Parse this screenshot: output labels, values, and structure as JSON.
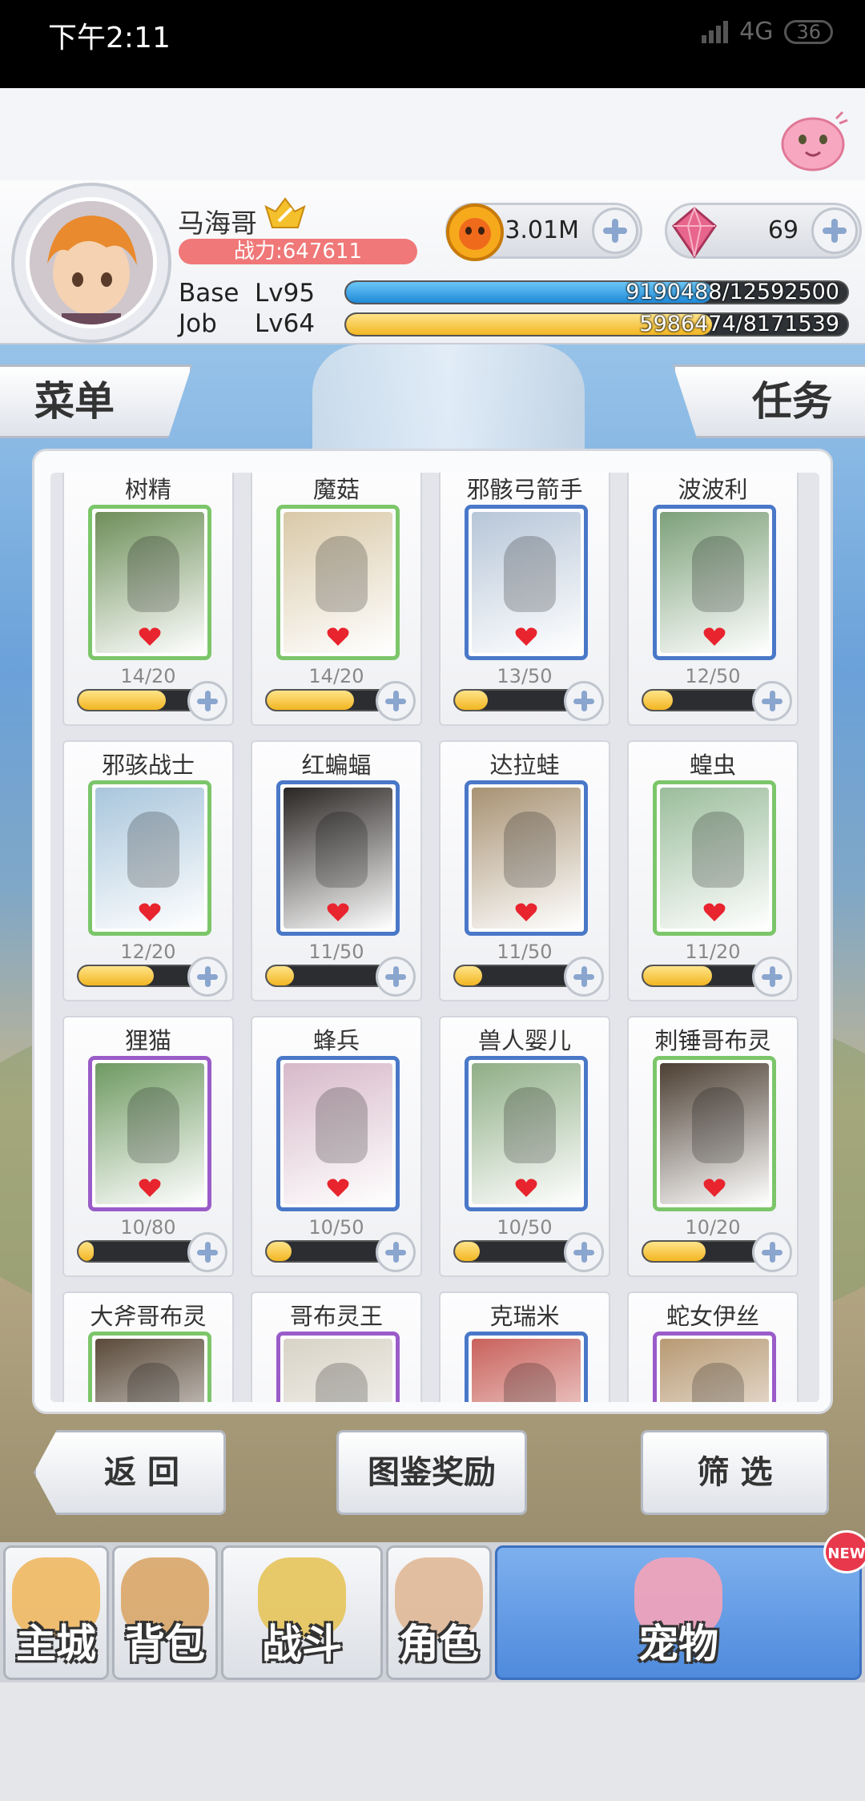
{
  "status_bar": {
    "time": "下午2:11",
    "network": "4G",
    "battery": "36"
  },
  "player": {
    "name": "马海哥",
    "power": "战力:647611",
    "gold": "3.01M",
    "gems": "69",
    "base": {
      "label": "Base",
      "level": "Lv95",
      "exp": "9190488/12592500",
      "progress": 0.73
    },
    "job": {
      "label": "Job",
      "level": "Lv64",
      "exp": "5986474/8171539",
      "progress": 0.73
    }
  },
  "tabs": {
    "menu": "菜单",
    "task": "任务"
  },
  "cards": [
    {
      "name": "树精",
      "count": "14/20",
      "progress": 0.7,
      "frame": "#7cc66a",
      "art": "#6e8f5a"
    },
    {
      "name": "魔菇",
      "count": "14/20",
      "progress": 0.7,
      "frame": "#7cc66a",
      "art": "#d9c9a8"
    },
    {
      "name": "邪骸弓箭手",
      "count": "13/50",
      "progress": 0.26,
      "frame": "#4a78c8",
      "art": "#b7c6d8"
    },
    {
      "name": "波波利",
      "count": "12/50",
      "progress": 0.24,
      "frame": "#4a78c8",
      "art": "#7da17a"
    },
    {
      "name": "邪骇战士",
      "count": "12/20",
      "progress": 0.6,
      "frame": "#7cc66a",
      "art": "#a9c6dc"
    },
    {
      "name": "红蝙蝠",
      "count": "11/50",
      "progress": 0.22,
      "frame": "#4a78c8",
      "art": "#2a2624"
    },
    {
      "name": "达拉蛙",
      "count": "11/50",
      "progress": 0.22,
      "frame": "#4a78c8",
      "art": "#a89273"
    },
    {
      "name": "蝗虫",
      "count": "11/20",
      "progress": 0.55,
      "frame": "#7cc66a",
      "art": "#9bbd9c"
    },
    {
      "name": "狸猫",
      "count": "10/80",
      "progress": 0.12,
      "frame": "#9a5cc8",
      "art": "#6f9a62"
    },
    {
      "name": "蜂兵",
      "count": "10/50",
      "progress": 0.2,
      "frame": "#4a78c8",
      "art": "#d7b9c9"
    },
    {
      "name": "兽人婴儿",
      "count": "10/50",
      "progress": 0.2,
      "frame": "#4a78c8",
      "art": "#8fae86"
    },
    {
      "name": "刺锤哥布灵",
      "count": "10/20",
      "progress": 0.5,
      "frame": "#7cc66a",
      "art": "#4c3f33"
    },
    {
      "name": "大斧哥布灵",
      "count": "",
      "progress": 0,
      "frame": "#7cc66a",
      "art": "#5a4a3a"
    },
    {
      "name": "哥布灵王",
      "count": "",
      "progress": 0,
      "frame": "#9a5cc8",
      "art": "#d8d3c6"
    },
    {
      "name": "克瑞米",
      "count": "",
      "progress": 0,
      "frame": "#4a78c8",
      "art": "#c9625c"
    },
    {
      "name": "蛇女伊丝",
      "count": "",
      "progress": 0,
      "frame": "#9a5cc8",
      "art": "#b89a74"
    }
  ],
  "buttons": {
    "back": "返 回",
    "reward": "图鉴奖励",
    "filter": "筛 选"
  },
  "nav": [
    {
      "label": "主城",
      "icon": "castle-icon",
      "color": "#f0b860",
      "active": false
    },
    {
      "label": "背包",
      "icon": "backpack-icon",
      "color": "#d9a668",
      "active": false
    },
    {
      "label": "战斗",
      "icon": "battle-shield-icon",
      "color": "#e5c45a",
      "active": false
    },
    {
      "label": "角色",
      "icon": "character-icon",
      "color": "#e0b897",
      "active": false
    },
    {
      "label": "宠物",
      "icon": "pet-poring-icon",
      "color": "#f5a3b8",
      "active": true
    }
  ],
  "new_badge": "NEW"
}
